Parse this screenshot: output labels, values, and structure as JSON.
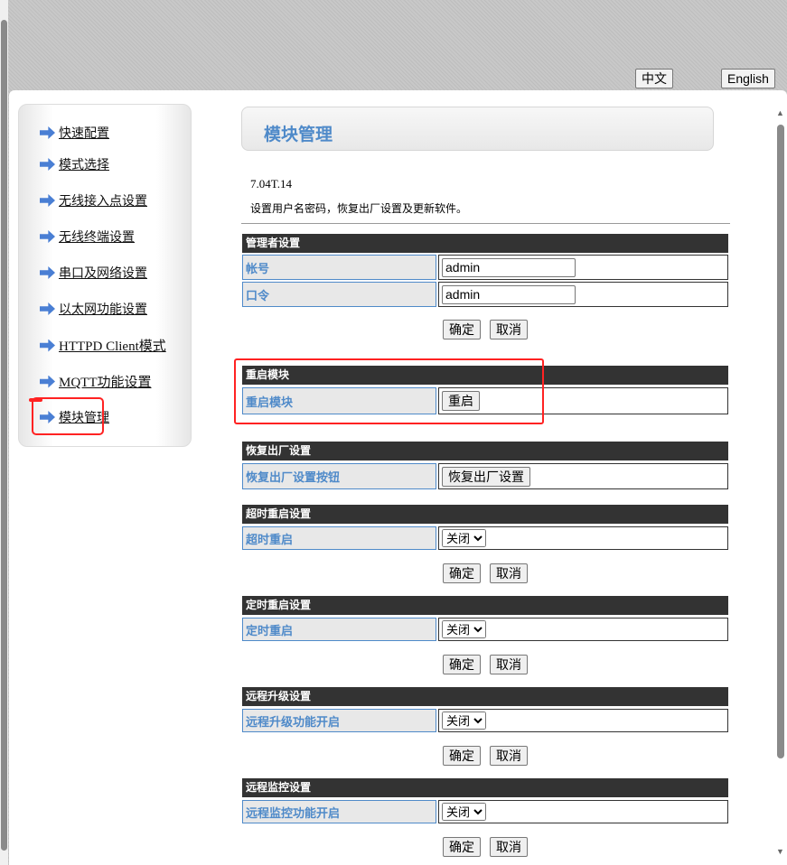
{
  "header": {
    "lang_zh": "中文",
    "lang_en": "English"
  },
  "sidebar": {
    "items": [
      {
        "label": "快速配置"
      },
      {
        "label": "模式选择"
      },
      {
        "label": "无线接入点设置"
      },
      {
        "label": "无线终端设置"
      },
      {
        "label": "串口及网络设置"
      },
      {
        "label": "以太网功能设置"
      },
      {
        "label": "HTTPD Client模式"
      },
      {
        "label": "MQTT功能设置"
      },
      {
        "label": "模块管理"
      }
    ]
  },
  "main": {
    "title": "模块管理",
    "version": "7.04T.14",
    "description": "设置用户名密码，恢复出厂设置及更新软件。",
    "confirm": "确定",
    "cancel": "取消",
    "admin": {
      "header": "管理者设置",
      "user_label": "帐号",
      "user_value": "admin",
      "pass_label": "口令",
      "pass_value": "admin"
    },
    "restart": {
      "header": "重启模块",
      "label": "重启模块",
      "button": "重启"
    },
    "factory": {
      "header": "恢复出厂设置",
      "label": "恢复出厂设置按钮",
      "button": "恢复出厂设置"
    },
    "timeout_restart": {
      "header": "超时重启设置",
      "label": "超时重启",
      "value": "关闭"
    },
    "timed_restart": {
      "header": "定时重启设置",
      "label": "定时重启",
      "value": "关闭"
    },
    "remote_upgrade": {
      "header": "远程升级设置",
      "label": "远程升级功能开启",
      "value": "关闭"
    },
    "remote_monitor": {
      "header": "远程监控设置",
      "label": "远程监控功能开启",
      "value": "关闭"
    }
  },
  "colors": {
    "accent": "#4f8ac9",
    "header_bar": "#333333",
    "annotation": "#ff2222"
  }
}
